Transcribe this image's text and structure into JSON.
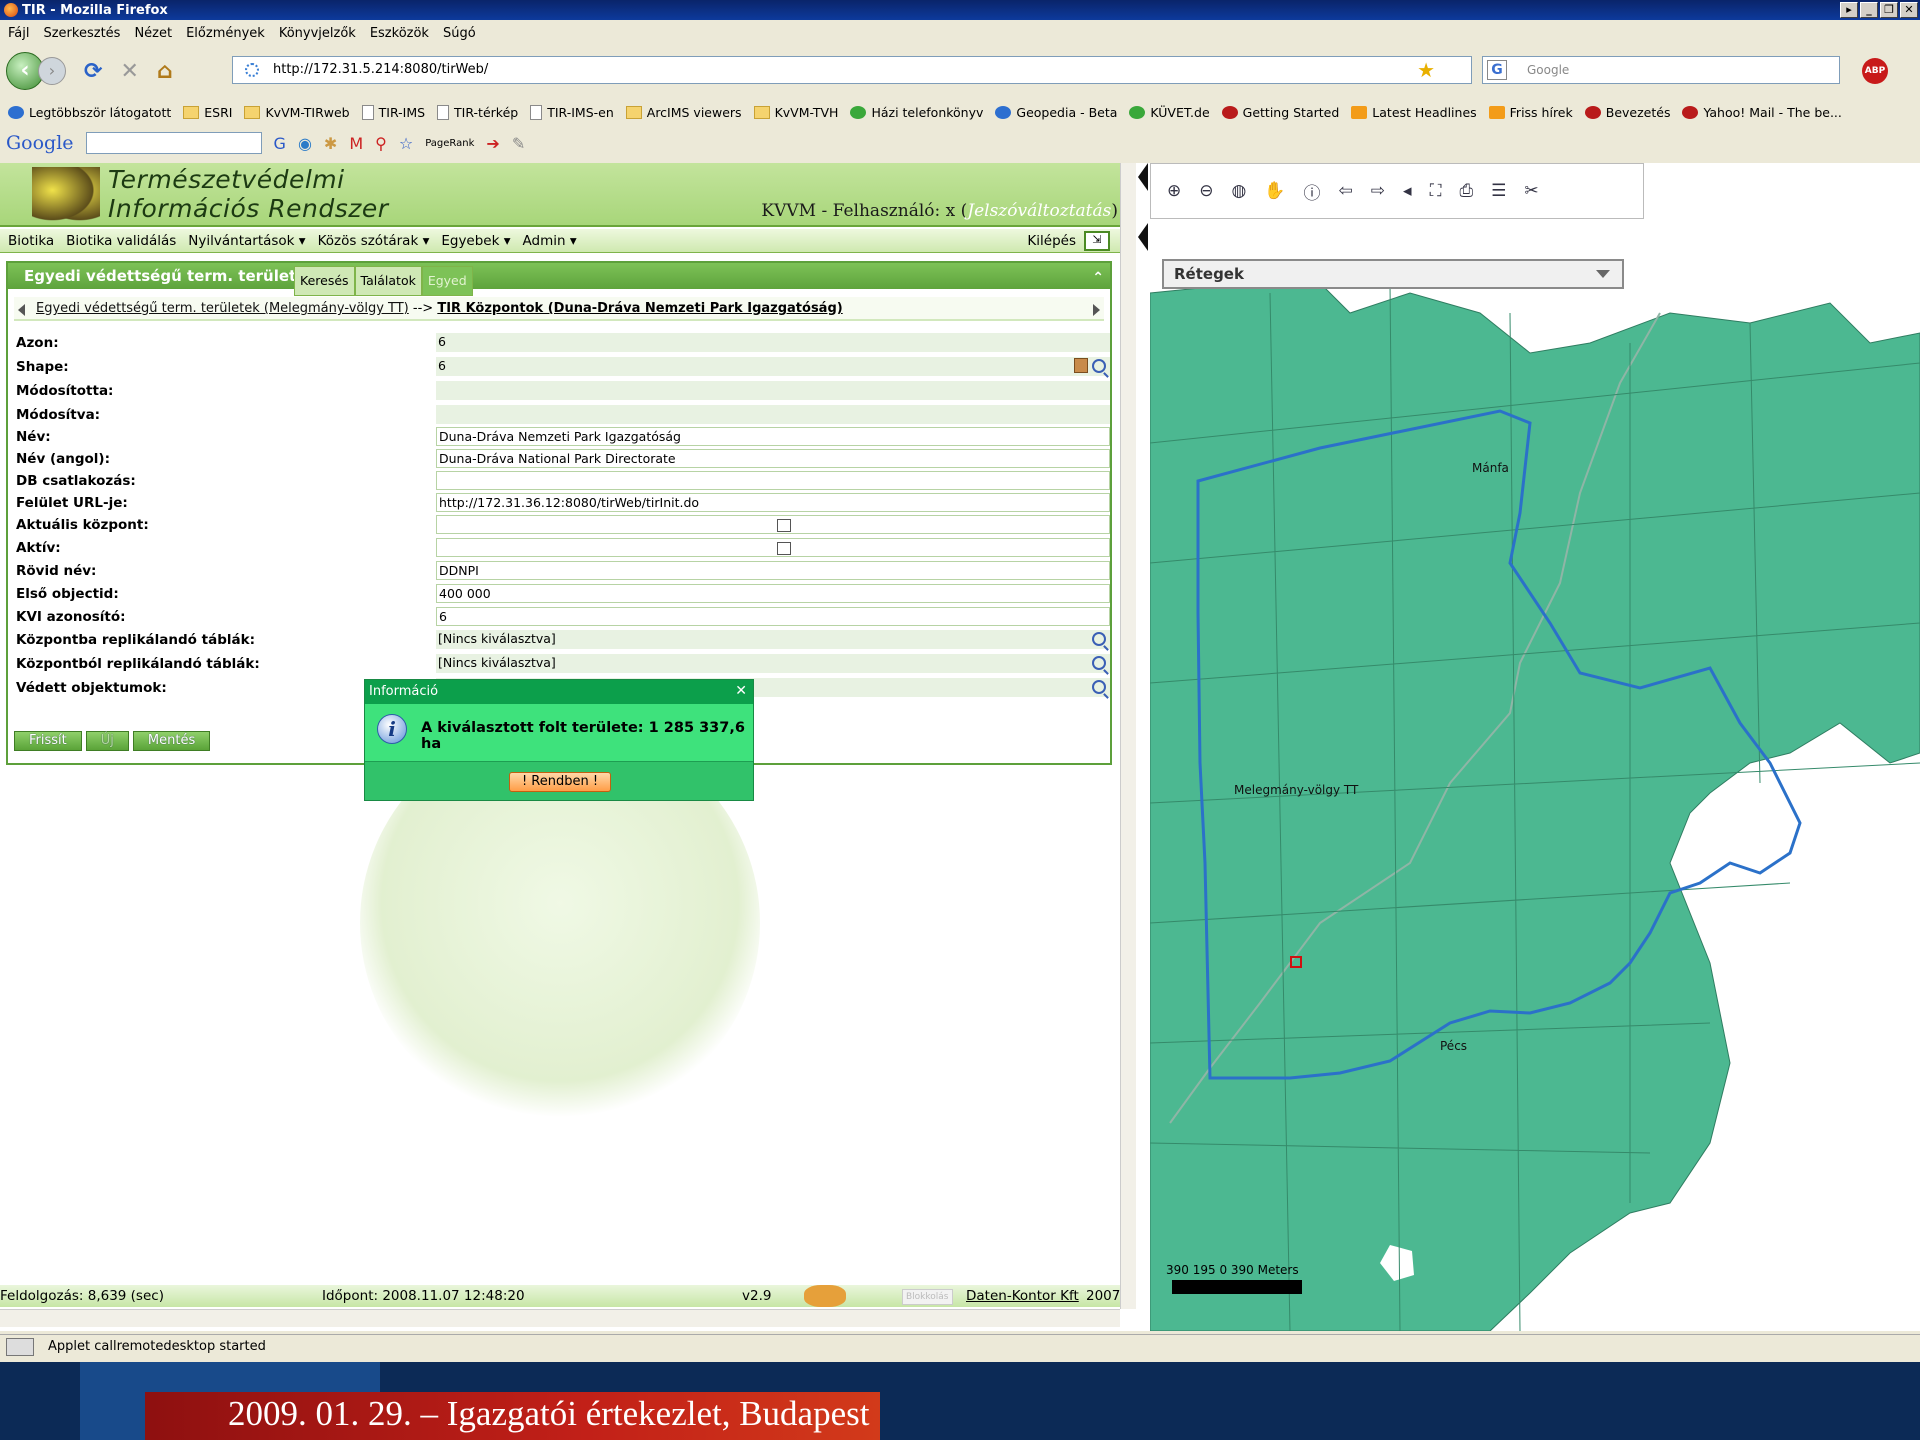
{
  "window": {
    "title": "TIR - Mozilla Firefox"
  },
  "menu": [
    "Fájl",
    "Szerkesztés",
    "Nézet",
    "Előzmények",
    "Könyvjelzők",
    "Eszközök",
    "Súgó"
  ],
  "address": {
    "url": "http://172.31.5.214:8080/tirWeb/",
    "search_placeholder": "Google"
  },
  "bookmarks": [
    "Legtöbbször látogatott",
    "ESRI",
    "KvVM-TIRweb",
    "TIR-IMS",
    "TIR-térkép",
    "TIR-IMS-en",
    "ArcIMS viewers",
    "KvVM-TVH",
    "Házi telefonkönyv",
    "Geopedia - Beta",
    "KÜVET.de",
    "Getting Started",
    "Latest Headlines",
    "Friss hírek",
    "Bevezetés",
    "Yahoo! Mail - The be..."
  ],
  "google_bar": {
    "logo": "Google",
    "pagerank": "PageRank"
  },
  "app": {
    "logo_line1": "Természetvédelmi",
    "logo_line2": "Információs Rendszer",
    "user_prefix": "KVVM - Felhasználó: x (",
    "user_link": "Jelszóváltoztatás",
    "user_suffix": ")",
    "nav": [
      "Biotika",
      "Biotika validálás",
      "Nyilvántartások ▾",
      "Közös szótárak ▾",
      "Egyebek ▾",
      "Admin ▾"
    ],
    "logout": "Kilépés"
  },
  "panel": {
    "title": "Egyedi védettségű term. területek",
    "tabs": [
      "Keresés",
      "Találatok",
      "Egyed"
    ],
    "breadcrumb_link": "Egyedi védettségű term. területek (Melegmány-völgy TT)",
    "breadcrumb_sep": "-->",
    "breadcrumb_current": "TIR Központok (Duna-Dráva Nemzeti Park Igazgatóság)",
    "fields": [
      {
        "label": "Azon:",
        "value": "6"
      },
      {
        "label": "Shape:",
        "value": "6"
      },
      {
        "label": "Módosította:",
        "value": ""
      },
      {
        "label": "Módosítva:",
        "value": ""
      },
      {
        "label": "Név:",
        "value": "Duna-Dráva Nemzeti Park Igazgatóság"
      },
      {
        "label": "Név (angol):",
        "value": "Duna-Dráva National Park Directorate"
      },
      {
        "label": "DB csatlakozás:",
        "value": ""
      },
      {
        "label": "Felület URL-je:",
        "value": "http://172.31.36.12:8080/tirWeb/tirInit.do"
      },
      {
        "label": "Aktuális központ:",
        "value": ""
      },
      {
        "label": "Aktív:",
        "value": ""
      },
      {
        "label": "Rövid név:",
        "value": "DDNPI"
      },
      {
        "label": "Első objectid:",
        "value": "400 000"
      },
      {
        "label": "KVI azonosító:",
        "value": "6"
      },
      {
        "label": "Központba replikálandó táblák:",
        "value": "[Nincs kiválasztva]"
      },
      {
        "label": "Központból replikálandó táblák:",
        "value": "[Nincs kiválasztva]"
      },
      {
        "label": "Védett objektumok:",
        "value": ""
      }
    ],
    "buttons": [
      "Frissít",
      "Új",
      "Mentés"
    ]
  },
  "dialog": {
    "title": "Információ",
    "message": "A kiválasztott folt területe: 1 285 337,6 ha",
    "ok": "! Rendben !"
  },
  "status": {
    "processing": "Feldolgozás: 8,639 (sec)",
    "time": "Időpont: 2008.11.07 12:48:20",
    "version": "v2.9",
    "badge": "Blokkolás",
    "company": "Daten-Kontor Kft",
    "year": "2007"
  },
  "map": {
    "layers_title": "Rétegek",
    "place1": "Melegmány-völgy TT",
    "place2": "Mánfa",
    "place3": "Pécs",
    "scale_text": "390   195  0         390 Meters",
    "fill_color": "#4cb891"
  },
  "statusbar": {
    "text": "Applet callremotedesktop started"
  },
  "footer": {
    "text": "2009. 01. 29. – Igazgatói értekezlet, Budapest"
  }
}
